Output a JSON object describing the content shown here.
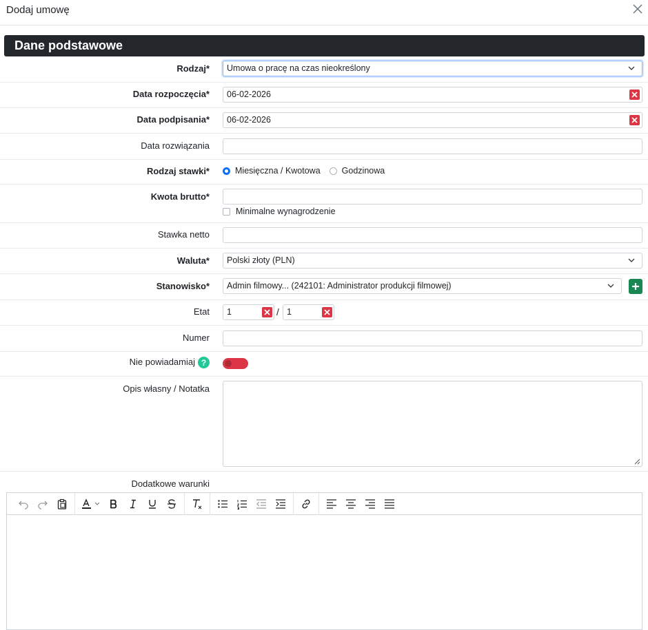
{
  "modal": {
    "title": "Dodaj umowę"
  },
  "section": {
    "title": "Dane podstawowe"
  },
  "fields": {
    "rodzaj": {
      "label": "Rodzaj*",
      "value": "Umowa o pracę na czas nieokreślony"
    },
    "data_rozpoczecia": {
      "label": "Data rozpoczęcia*",
      "value": "06-02-2026"
    },
    "data_podpisania": {
      "label": "Data podpisania*",
      "value": "06-02-2026"
    },
    "data_rozwiazania": {
      "label": "Data rozwiązania",
      "value": ""
    },
    "rodzaj_stawki": {
      "label": "Rodzaj stawki*",
      "options": [
        "Miesięczna / Kwotowa",
        "Godzinowa"
      ],
      "selected": "Miesięczna / Kwotowa"
    },
    "kwota_brutto": {
      "label": "Kwota brutto*",
      "value": "",
      "checkbox_label": "Minimalne wynagrodzenie",
      "checked": false
    },
    "stawka_netto": {
      "label": "Stawka netto",
      "value": ""
    },
    "waluta": {
      "label": "Waluta*",
      "value": "Polski złoty (PLN)"
    },
    "stanowisko": {
      "label": "Stanowisko*",
      "value": "Admin filmowy... (242101: Administrator produkcji filmowej)"
    },
    "etat": {
      "label": "Etat",
      "numerator": "1",
      "separator": "/",
      "denominator": "1"
    },
    "numer": {
      "label": "Numer",
      "value": ""
    },
    "nie_powiadamiaj": {
      "label": "Nie powiadamiaj",
      "help": "?",
      "enabled": false
    },
    "opis": {
      "label": "Opis własny / Notatka",
      "value": ""
    },
    "dodatkowe_warunki": {
      "label": "Dodatkowe warunki"
    }
  },
  "editor_toolbar": {
    "groups": [
      [
        "undo-icon",
        "redo-icon",
        "paste-icon"
      ],
      [
        "text-color-icon",
        "bold-icon",
        "italic-icon",
        "underline-icon",
        "strikethrough-icon"
      ],
      [
        "clear-format-icon"
      ],
      [
        "bullet-list-icon",
        "numbered-list-icon",
        "outdent-icon",
        "indent-icon"
      ],
      [
        "link-icon"
      ],
      [
        "align-left-icon",
        "align-center-icon",
        "align-right-icon",
        "align-justify-icon"
      ]
    ]
  },
  "colors": {
    "section_bg": "#23272b",
    "danger": "#dc3545",
    "success": "#198754",
    "help": "#20c997",
    "primary": "#0d6efd"
  }
}
